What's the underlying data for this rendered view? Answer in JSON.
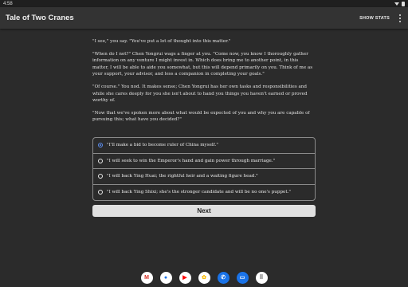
{
  "status_bar": {
    "time": "4:58"
  },
  "app_bar": {
    "title": "Tale of Two Cranes",
    "show_stats_label": "SHOW STATS"
  },
  "story": {
    "paragraphs": [
      "\"I see,\" you say. \"You've put a lot of thought into this matter.\"",
      "\"When do I not?\" Chen Yongrui wags a finger at you. \"Come now, you know I thoroughly gather information on any venture I might invest in. Which does bring me to another point, in this matter, I will be able to aide you somewhat, but this will depend primarily on you. Think of me as your support, your advisor, and less a companion in completing your goals.\"",
      "\"Of course.\" You nod. It makes sense; Chen Yongrui has her own tasks and responsibilities and while she cares deeply for you she isn't about to hand you things you haven't earned or proved worthy of.",
      "\"Now that we've spoken more about what would be expected of you and why you are capable of pursuing this; what have you decided?\""
    ]
  },
  "choices": [
    {
      "label": "\"I'll make a bid to become ruler of China myself.\"",
      "selected": true
    },
    {
      "label": "\"I will seek to win the Emperor's hand and gain power through marriage.\"",
      "selected": false
    },
    {
      "label": "\"I will back Ying Huai; the rightful heir and a waiting figure head.\"",
      "selected": false
    },
    {
      "label": "\"I will back Ying Shixi; she's the stronger candidate and will be no one's puppet.\"",
      "selected": false
    }
  ],
  "next_button_label": "Next",
  "dock": [
    {
      "name": "gmail-icon",
      "glyph": "M",
      "bg": "#ffffff",
      "fg": "#d93025"
    },
    {
      "name": "chrome-icon",
      "glyph": "●",
      "bg": "#ffffff",
      "fg": "#1a73e8"
    },
    {
      "name": "youtube-icon",
      "glyph": "▶",
      "bg": "#ffffff",
      "fg": "#ff0000"
    },
    {
      "name": "photos-icon",
      "glyph": "✿",
      "bg": "#ffffff",
      "fg": "#fbbc04"
    },
    {
      "name": "phone-icon",
      "glyph": "✆",
      "bg": "#1a73e8",
      "fg": "#ffffff"
    },
    {
      "name": "messages-icon",
      "glyph": "▭",
      "bg": "#1a73e8",
      "fg": "#ffffff"
    },
    {
      "name": "app-drawer-icon",
      "glyph": "⠿",
      "bg": "#ffffff",
      "fg": "#444444"
    }
  ]
}
